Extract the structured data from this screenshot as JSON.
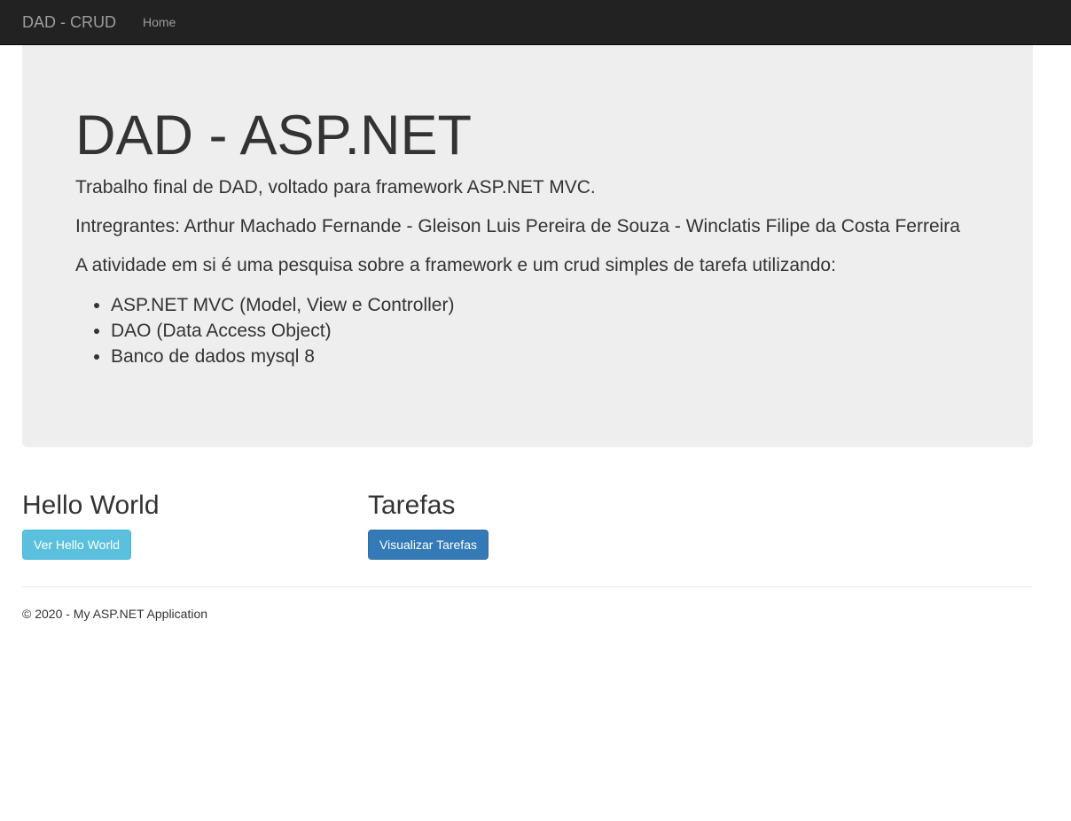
{
  "navbar": {
    "brand": "DAD - CRUD",
    "links": [
      {
        "label": "Home"
      }
    ]
  },
  "jumbotron": {
    "title": "DAD - ASP.NET",
    "lead_1": "Trabalho final de DAD, voltado para framework ASP.NET MVC.",
    "lead_2": "Intregrantes: Arthur Machado Fernande - Gleison Luis Pereira de Souza - Winclatis Filipe da Costa Ferreira",
    "lead_3": "A atividade em si é uma pesquisa sobre a framework e um crud simples de tarefa utilizando:",
    "items": [
      "ASP.NET MVC (Model, View e Controller)",
      "DAO (Data Access Object)",
      "Banco de dados mysql 8"
    ]
  },
  "sections": {
    "hello": {
      "title": "Hello World",
      "button": "Ver Hello World"
    },
    "tasks": {
      "title": "Tarefas",
      "button": "Visualizar Tarefas"
    }
  },
  "footer": {
    "text": "© 2020 - My ASP.NET Application"
  },
  "colors": {
    "navbar_bg": "#222222",
    "jumbotron_bg": "#eeeeee",
    "btn_info": "#5bc0de",
    "btn_primary": "#337ab7"
  }
}
